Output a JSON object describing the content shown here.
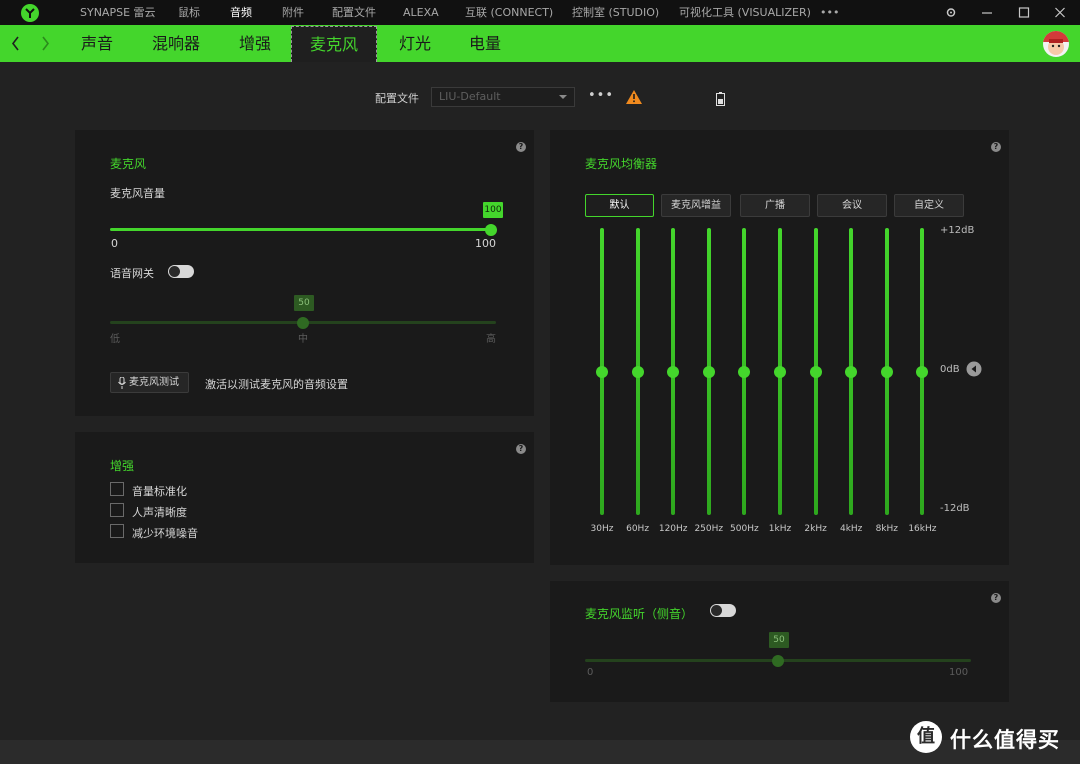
{
  "titlebar": {
    "nav": [
      "SYNAPSE 雷云",
      "鼠标",
      "音频",
      "附件",
      "配置文件",
      "ALEXA",
      "互联 (CONNECT)",
      "控制室 (STUDIO)",
      "可视化工具 (VISUALIZER)",
      "•••"
    ],
    "active_nav": "音频",
    "controls": [
      "gear-icon",
      "minimize-icon",
      "maximize-icon",
      "close-icon"
    ]
  },
  "tabbar": {
    "tabs": [
      "声音",
      "混响器",
      "增强",
      "麦克风",
      "灯光",
      "电量"
    ],
    "active_tab": "麦克风",
    "accent": "#44d62c"
  },
  "profile": {
    "label": "配置文件",
    "selected": "LIU-Default",
    "more": "•••"
  },
  "mic_panel": {
    "title": "麦克风",
    "volume_label": "麦克风音量",
    "volume_value": "100",
    "volume_min": "0",
    "volume_max": "100",
    "volume_level": 100,
    "voice_gate_label": "语音网关",
    "voice_gate_on": false,
    "gate_value": "50",
    "gate_level": 50,
    "gate_low": "低",
    "gate_mid": "中",
    "gate_high": "高",
    "test_button": "麦克风测试",
    "test_hint": "激活以测试麦克风的音频设置",
    "help": "?"
  },
  "enhance_panel": {
    "title": "增强",
    "options": [
      "音量标准化",
      "人声清晰度",
      "减少环境噪音"
    ],
    "help": "?"
  },
  "eq_panel": {
    "title": "麦克风均衡器",
    "presets": [
      "默认",
      "麦克风增益",
      "广播",
      "会议",
      "自定义"
    ],
    "selected_preset": "默认",
    "bands": [
      "30Hz",
      "60Hz",
      "120Hz",
      "250Hz",
      "500Hz",
      "1kHz",
      "2kHz",
      "4kHz",
      "8kHz",
      "16kHz"
    ],
    "band_gains_db": [
      0,
      0,
      0,
      0,
      0,
      0,
      0,
      0,
      0,
      0
    ],
    "max_label": "+12dB",
    "zero_label": "0dB",
    "min_label": "-12dB",
    "help": "?"
  },
  "monitor_panel": {
    "title": "麦克风监听（侧音）",
    "enabled": false,
    "value": "50",
    "level": 50,
    "min": "0",
    "max": "100",
    "help": "?"
  },
  "watermark": {
    "badge": "值",
    "text": "什么值得买"
  }
}
